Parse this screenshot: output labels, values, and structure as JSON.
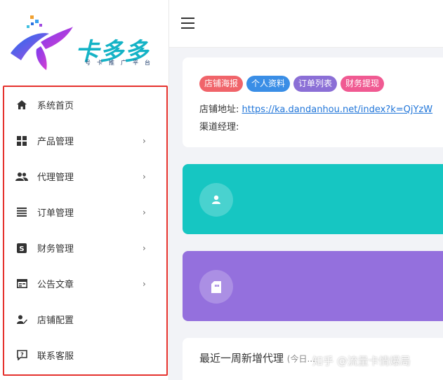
{
  "app": {
    "logo_text": "卡多多",
    "logo_subtitle": "号卡推广平台"
  },
  "sidebar": {
    "items": [
      {
        "label": "系统首页",
        "icon": "home-icon",
        "has_arrow": false
      },
      {
        "label": "产品管理",
        "icon": "grid-icon",
        "has_arrow": true
      },
      {
        "label": "代理管理",
        "icon": "people-icon",
        "has_arrow": true
      },
      {
        "label": "订单管理",
        "icon": "list-icon",
        "has_arrow": true
      },
      {
        "label": "财务管理",
        "icon": "finance-icon",
        "has_arrow": true
      },
      {
        "label": "公告文章",
        "icon": "article-icon",
        "has_arrow": true
      },
      {
        "label": "店铺配置",
        "icon": "shop-config-icon",
        "has_arrow": false
      },
      {
        "label": "联系客服",
        "icon": "help-icon",
        "has_arrow": false
      }
    ],
    "arrow": "›"
  },
  "main": {
    "tags": [
      {
        "label": "店铺海报",
        "color": "#f0646a"
      },
      {
        "label": "个人资料",
        "color": "#3a8ee6"
      },
      {
        "label": "订单列表",
        "color": "#8b6fd6"
      },
      {
        "label": "财务提现",
        "color": "#f05a92"
      }
    ],
    "store_address_label": "店铺地址:",
    "store_address_url": "https://ka.dandanhou.net/index?k=QjYzW",
    "channel_manager_label": "渠道经理:",
    "stat_cards": [
      {
        "color": "#16c6c2",
        "icon": "user-icon"
      },
      {
        "color": "#9470dd",
        "icon": "sim-card-icon"
      }
    ],
    "recent_title": "最近一周新增代理",
    "recent_subtitle": "(今日...",
    "watermark": "知乎 @流量卡情爆局"
  },
  "colors": {
    "accent_red": "#e5312d",
    "logo_teal": "#14b3c6"
  }
}
